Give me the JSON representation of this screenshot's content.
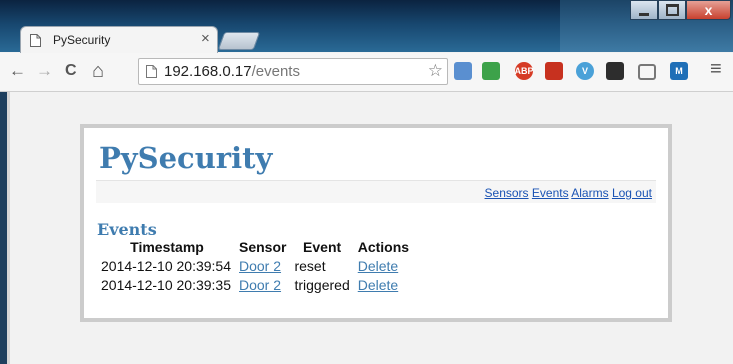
{
  "browser": {
    "tab": {
      "title": "PySecurity",
      "close_glyph": "×"
    },
    "url": {
      "host": "192.168.0.17",
      "path": "/events"
    },
    "nav": {
      "back": "←",
      "forward": "→",
      "reload": "C",
      "home": "⌂"
    },
    "extensions": [
      {
        "name": "search-extension-icon",
        "label": "",
        "color": "#5a8fd0"
      },
      {
        "name": "pocket-extension-icon",
        "label": "",
        "color": "#3da24a"
      },
      {
        "name": "adblock-extension-icon",
        "label": "ABP",
        "color": "#d63b25"
      },
      {
        "name": "plus-extension-icon",
        "label": "",
        "color": "#c7311f"
      },
      {
        "name": "v-extension-icon",
        "label": "V",
        "color": "#4aa1d8"
      },
      {
        "name": "film-extension-icon",
        "label": "",
        "color": "#2d2d2d"
      },
      {
        "name": "cast-icon",
        "label": "",
        "color": "#777777"
      },
      {
        "name": "m-extension-icon",
        "label": "M",
        "color": "#1f6fb7"
      }
    ],
    "menu_glyph": "≡",
    "window_close": "x"
  },
  "page": {
    "title": "PySecurity",
    "nav_links": [
      "Sensors",
      "Events",
      "Alarms",
      "Log out"
    ],
    "section_title": "Events",
    "table": {
      "headers": [
        "Timestamp",
        "Sensor",
        "Event",
        "Actions"
      ],
      "rows": [
        {
          "timestamp": "2014-12-10 20:39:54",
          "sensor": "Door 2",
          "event": "reset",
          "action": "Delete"
        },
        {
          "timestamp": "2014-12-10 20:39:35",
          "sensor": "Door 2",
          "event": "triggered",
          "action": "Delete"
        }
      ]
    }
  }
}
